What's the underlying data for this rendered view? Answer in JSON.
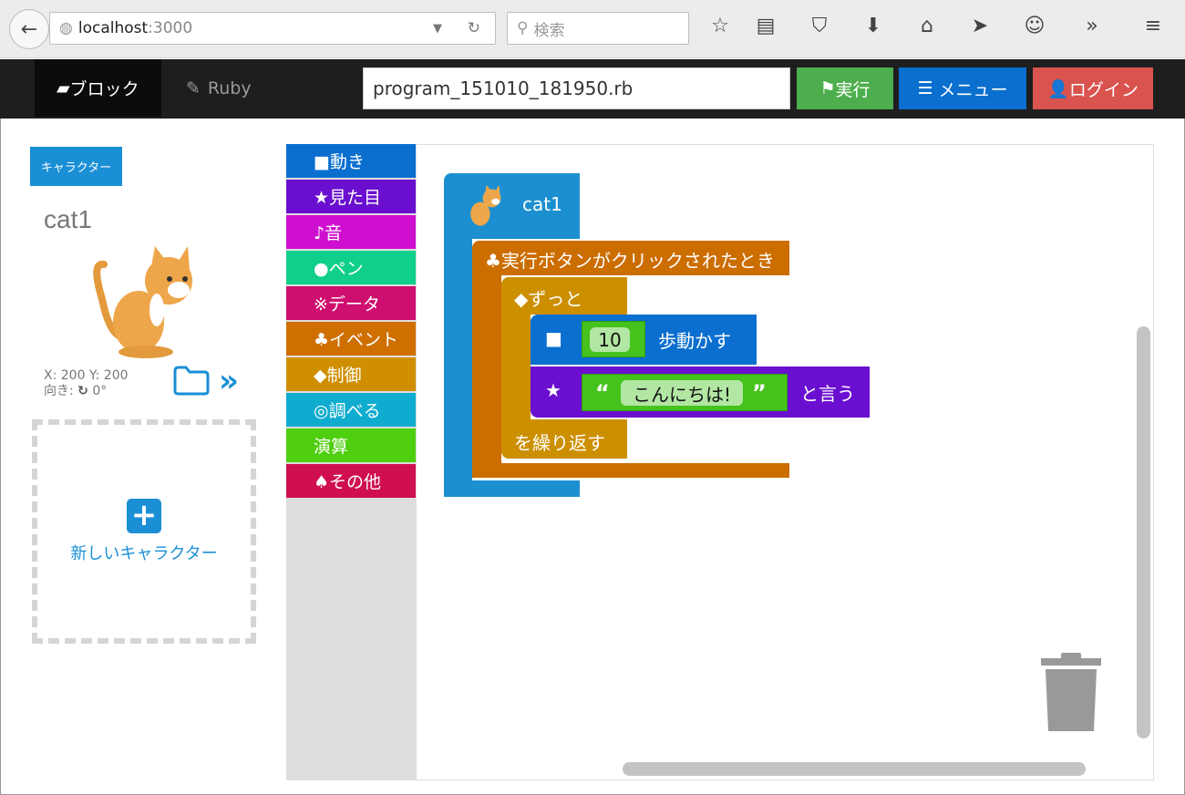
{
  "browser": {
    "url_host": "localhost",
    "url_port": ":3000",
    "search_placeholder": "検索"
  },
  "nav": {
    "tab_block": "ブロック",
    "tab_ruby": "Ruby",
    "filename": "program_151010_181950.rb",
    "run": "実行",
    "menu": "メニュー",
    "login": "ログイン"
  },
  "sidebar": {
    "character_button": "キャラクター",
    "character_name": "cat1",
    "coords": "X: 200 Y: 200",
    "direction_label": "向き:",
    "direction_value": "0°",
    "new_character": "新しいキャラクター"
  },
  "categories": [
    {
      "label": "■動き",
      "color": "#0a6fcf"
    },
    {
      "label": "★見た目",
      "color": "#6a0fcf"
    },
    {
      "label": "♪音",
      "color": "#cf0fcf"
    },
    {
      "label": "●ペン",
      "color": "#0fcf8a"
    },
    {
      "label": "※データ",
      "color": "#cf0f6f"
    },
    {
      "label": "♣イベント",
      "color": "#cf6f00"
    },
    {
      "label": "◆制御",
      "color": "#cf8f00"
    },
    {
      "label": "◎調べる",
      "color": "#0faccf"
    },
    {
      "label": "演算",
      "color": "#4fcf0f"
    },
    {
      "label": "♠その他",
      "color": "#cf0f4f"
    }
  ],
  "blocks": {
    "character": "cat1",
    "event": "♣実行ボタンがクリックされたとき",
    "forever": "◆ずっと",
    "forever_end": "を繰り返す",
    "move_icon": "■",
    "move_value": "10",
    "move_label": "歩動かす",
    "say_icon": "★",
    "say_open": "“",
    "say_value": "こんにちは!",
    "say_close": "”",
    "say_label": "と言う"
  }
}
